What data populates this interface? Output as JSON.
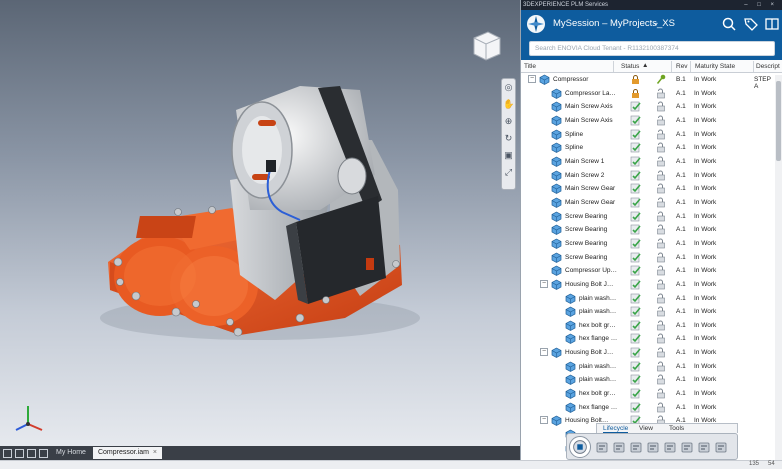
{
  "panel": {
    "window_title": "3DEXPERIENCE PLM Services",
    "window_controls": "– □ ×",
    "session_title": "MySession – MyProjects_XS",
    "search_placeholder": "Search ENOVIA Cloud Tenant - R1132100387374",
    "columns": {
      "title": "Title",
      "status": "Status",
      "rev": "Rev",
      "maturity": "Maturity State",
      "description": "Descript"
    }
  },
  "tree_rows": [
    {
      "title": "Compressor",
      "depth": 0,
      "expander": "−",
      "rev": "B.1",
      "maturity": "In Work",
      "desc": "STEP A",
      "status": "lock-orange",
      "lock": "key-green"
    },
    {
      "title": "Compressor La…",
      "depth": 1,
      "expander": "",
      "rev": "A.1",
      "maturity": "In Work",
      "desc": "",
      "status": "lock-orange",
      "lock": "lock-open"
    },
    {
      "title": "Main Screw Axis",
      "depth": 1,
      "expander": "",
      "rev": "A.1",
      "maturity": "In Work",
      "desc": "",
      "status": "check-green",
      "lock": "lock-open"
    },
    {
      "title": "Main Screw Axis",
      "depth": 1,
      "expander": "",
      "rev": "A.1",
      "maturity": "In Work",
      "desc": "",
      "status": "check-green",
      "lock": "lock-open"
    },
    {
      "title": "Spline",
      "depth": 1,
      "expander": "",
      "rev": "A.1",
      "maturity": "In Work",
      "desc": "",
      "status": "check-green",
      "lock": "lock-open"
    },
    {
      "title": "Spline",
      "depth": 1,
      "expander": "",
      "rev": "A.1",
      "maturity": "In Work",
      "desc": "",
      "status": "check-green",
      "lock": "lock-open"
    },
    {
      "title": "Main Screw 1",
      "depth": 1,
      "expander": "",
      "rev": "A.1",
      "maturity": "In Work",
      "desc": "",
      "status": "check-green",
      "lock": "lock-open"
    },
    {
      "title": "Main Screw 2",
      "depth": 1,
      "expander": "",
      "rev": "A.1",
      "maturity": "In Work",
      "desc": "",
      "status": "check-green",
      "lock": "lock-open"
    },
    {
      "title": "Main Screw Gear",
      "depth": 1,
      "expander": "",
      "rev": "A.1",
      "maturity": "In Work",
      "desc": "",
      "status": "check-green",
      "lock": "lock-open"
    },
    {
      "title": "Main Screw Gear",
      "depth": 1,
      "expander": "",
      "rev": "A.1",
      "maturity": "In Work",
      "desc": "",
      "status": "check-green",
      "lock": "lock-open"
    },
    {
      "title": "Screw Bearing",
      "depth": 1,
      "expander": "",
      "rev": "A.1",
      "maturity": "In Work",
      "desc": "",
      "status": "check-green",
      "lock": "lock-open"
    },
    {
      "title": "Screw Bearing",
      "depth": 1,
      "expander": "",
      "rev": "A.1",
      "maturity": "In Work",
      "desc": "",
      "status": "check-green",
      "lock": "lock-open"
    },
    {
      "title": "Screw Bearing",
      "depth": 1,
      "expander": "",
      "rev": "A.1",
      "maturity": "In Work",
      "desc": "",
      "status": "check-green",
      "lock": "lock-open"
    },
    {
      "title": "Screw Bearing",
      "depth": 1,
      "expander": "",
      "rev": "A.1",
      "maturity": "In Work",
      "desc": "",
      "status": "check-green",
      "lock": "lock-open"
    },
    {
      "title": "Compressor Up…",
      "depth": 1,
      "expander": "",
      "rev": "A.1",
      "maturity": "In Work",
      "desc": "",
      "status": "check-green",
      "lock": "lock-open"
    },
    {
      "title": "Housing Bolt J…",
      "depth": 1,
      "expander": "−",
      "rev": "A.1",
      "maturity": "In Work",
      "desc": "",
      "status": "check-green",
      "lock": "lock-open"
    },
    {
      "title": "plain wash…",
      "depth": 2,
      "expander": "",
      "rev": "A.1",
      "maturity": "In Work",
      "desc": "",
      "status": "check-green",
      "lock": "lock-open"
    },
    {
      "title": "plain wash…",
      "depth": 2,
      "expander": "",
      "rev": "A.1",
      "maturity": "In Work",
      "desc": "",
      "status": "check-green",
      "lock": "lock-open"
    },
    {
      "title": "hex bolt gr…",
      "depth": 2,
      "expander": "",
      "rev": "A.1",
      "maturity": "In Work",
      "desc": "",
      "status": "check-green",
      "lock": "lock-open"
    },
    {
      "title": "hex flange …",
      "depth": 2,
      "expander": "",
      "rev": "A.1",
      "maturity": "In Work",
      "desc": "",
      "status": "check-green",
      "lock": "lock-open"
    },
    {
      "title": "Housing Bolt J…",
      "depth": 1,
      "expander": "−",
      "rev": "A.1",
      "maturity": "In Work",
      "desc": "",
      "status": "check-green",
      "lock": "lock-open"
    },
    {
      "title": "plain wash…",
      "depth": 2,
      "expander": "",
      "rev": "A.1",
      "maturity": "In Work",
      "desc": "",
      "status": "check-green",
      "lock": "lock-open"
    },
    {
      "title": "plain wash…",
      "depth": 2,
      "expander": "",
      "rev": "A.1",
      "maturity": "In Work",
      "desc": "",
      "status": "check-green",
      "lock": "lock-open"
    },
    {
      "title": "hex bolt gr…",
      "depth": 2,
      "expander": "",
      "rev": "A.1",
      "maturity": "In Work",
      "desc": "",
      "status": "check-green",
      "lock": "lock-open"
    },
    {
      "title": "hex flange …",
      "depth": 2,
      "expander": "",
      "rev": "A.1",
      "maturity": "In Work",
      "desc": "",
      "status": "check-green",
      "lock": "lock-open"
    },
    {
      "title": "Housing Bolt…",
      "depth": 1,
      "expander": "−",
      "rev": "A.1",
      "maturity": "In Work",
      "desc": "",
      "status": "check-green",
      "lock": "lock-open"
    },
    {
      "title": "",
      "depth": 2,
      "expander": "",
      "rev": "",
      "maturity": "",
      "desc": "",
      "status": "check-green",
      "lock": "lock-open"
    },
    {
      "title": "",
      "depth": 2,
      "expander": "",
      "rev": "",
      "maturity": "",
      "desc": "",
      "status": "",
      "lock": ""
    }
  ],
  "floating_toolbar": {
    "tabs": [
      "Lifecycle",
      "View",
      "Tools"
    ],
    "active_tab": "Lifecycle",
    "buttons": [
      "lock-icon",
      "unlock-icon",
      "document-icon",
      "checkin-icon",
      "lifecycle-icon",
      "revise-icon",
      "split-icon",
      "tools-icon"
    ]
  },
  "document_tabs": {
    "icons": [
      "grid-icon",
      "tile-icon",
      "list-icon",
      "cascade-icon"
    ],
    "items": [
      {
        "label": "My Home",
        "active": false,
        "closable": false
      },
      {
        "label": "Compressor.iam",
        "active": true,
        "closable": true
      }
    ],
    "close_glyph": "×"
  },
  "status_bar": {
    "value_1": "135",
    "value_2": "54"
  },
  "viewport": {
    "viewcube_face": "FRONT"
  },
  "colors": {
    "header_blue": "#0e5c9e",
    "accent_orange": "#e8561e",
    "status_green": "#3aa449",
    "key_green": "#6fa522"
  }
}
